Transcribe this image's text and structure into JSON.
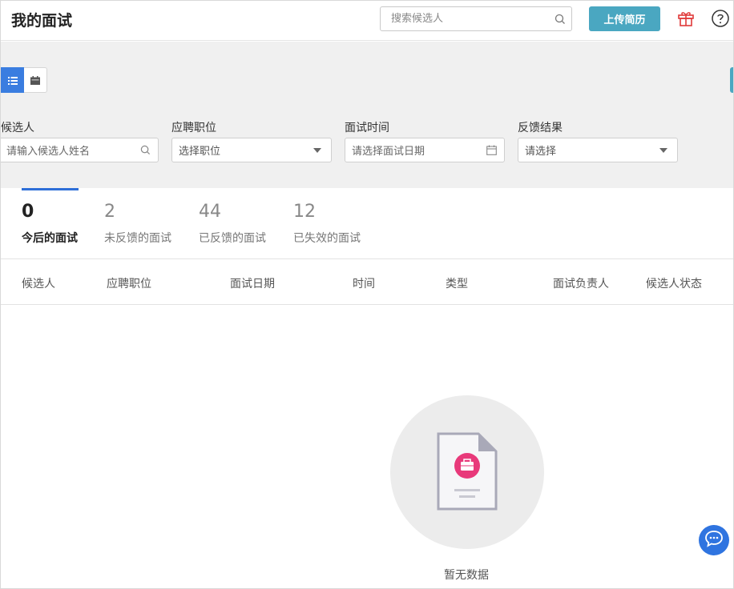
{
  "header": {
    "title": "我的面试",
    "search_placeholder": "搜索候选人",
    "upload_button": "上传简历"
  },
  "filters": {
    "candidate": {
      "label": "候选人",
      "placeholder": "请输入候选人姓名"
    },
    "position": {
      "label": "应聘职位",
      "value": "选择职位"
    },
    "interview_time": {
      "label": "面试时间",
      "placeholder": "请选择面试日期"
    },
    "feedback": {
      "label": "反馈结果",
      "value": "请选择"
    }
  },
  "tabs": [
    {
      "count": "0",
      "label": "今后的面试",
      "active": true
    },
    {
      "count": "2",
      "label": "未反馈的面试",
      "active": false
    },
    {
      "count": "44",
      "label": "已反馈的面试",
      "active": false
    },
    {
      "count": "12",
      "label": "已失效的面试",
      "active": false
    }
  ],
  "table": {
    "columns": [
      "候选人",
      "应聘职位",
      "面试日期",
      "时间",
      "类型",
      "面试负责人",
      "候选人状态"
    ]
  },
  "empty_state": {
    "text": "暂无数据"
  },
  "colors": {
    "primary": "#2e6fd8",
    "upload": "#4aa7c1",
    "gift": "#e03a3a",
    "empty_icon": "#e8397a"
  },
  "icons": [
    "search-icon",
    "gift-icon",
    "help-icon",
    "list-view-icon",
    "calendar-view-icon",
    "calendar-icon",
    "chat-icon",
    "briefcase-icon"
  ]
}
